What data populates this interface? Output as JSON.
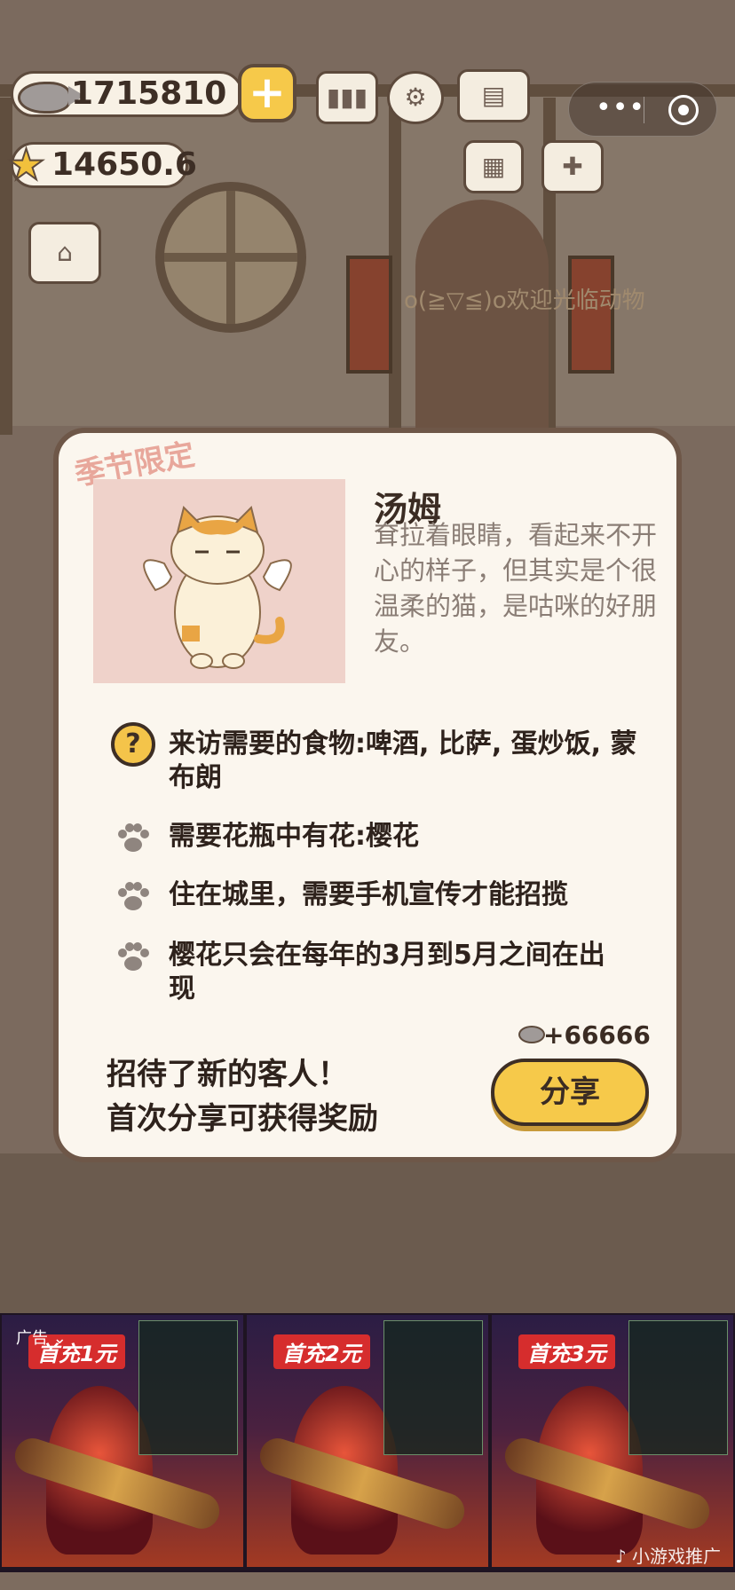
{
  "hud": {
    "fish_amount": "1715810",
    "star_amount": "14650.6"
  },
  "mini_program": {
    "more_icon": "more-dots-icon",
    "close_icon": "target-close-icon"
  },
  "background": {
    "welcome_text": "o(≧▽≦)o欢迎光临动物"
  },
  "modal": {
    "season_tag": "季节限定",
    "cat_name": "汤姆",
    "cat_description": "耷拉着眼睛，看起来不开心的样子，但其实是个很温柔的猫，是咕咪的好朋友。",
    "conditions": [
      "来访需要的食物:啤酒, 比萨, 蛋炒饭, 蒙布朗",
      "需要花瓶中有花:樱花",
      "住在城里，需要手机宣传才能招揽",
      "樱花只会在每年的3月到5月之间在出现"
    ],
    "reward": "+66666",
    "share_message_line1": "招待了新的客人！",
    "share_message_line2": "首次分享可获得奖励",
    "share_button": "分享"
  },
  "ads": {
    "label": "广告",
    "source": "小游戏推广",
    "cards": [
      {
        "badge": "首充1元"
      },
      {
        "badge": "首充2元"
      },
      {
        "badge": "首充3元"
      }
    ]
  },
  "colors": {
    "accent_yellow": "#f6c94a",
    "modal_bg": "#fbf6ee",
    "modal_border": "#6e5748",
    "season_pink": "#e8a79b"
  }
}
